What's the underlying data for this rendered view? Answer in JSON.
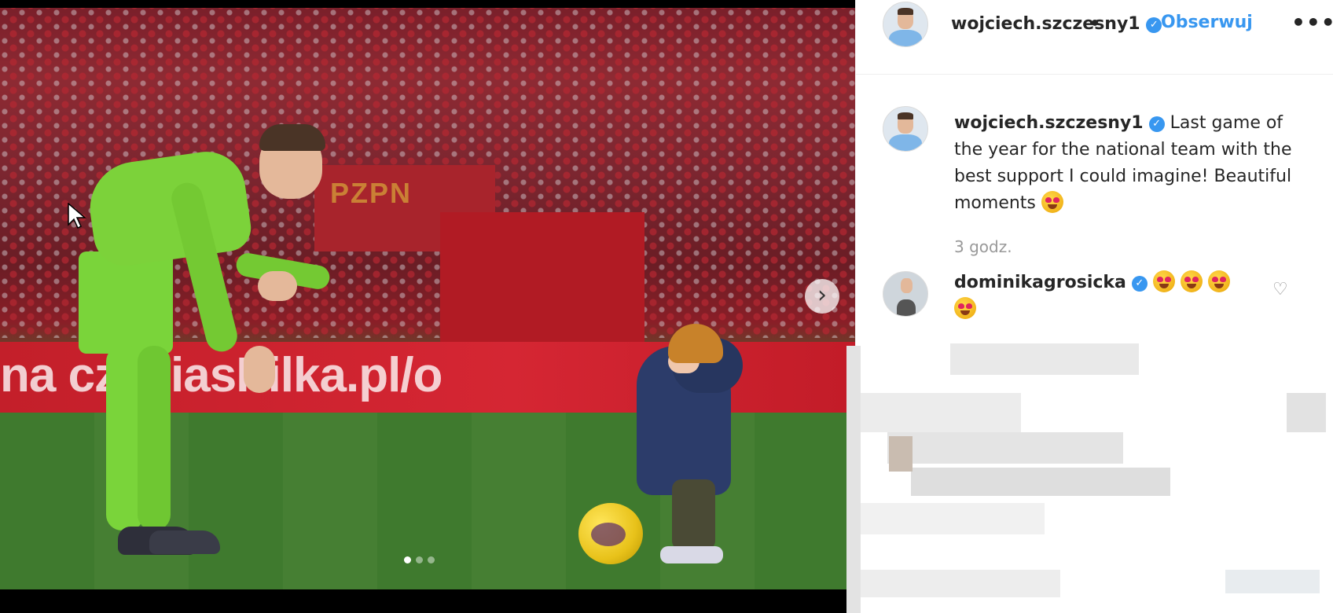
{
  "post": {
    "carousel": {
      "banner_text": "na   czysiasPilka.pl/o",
      "tunnel_sign": "PZPN",
      "dots": [
        true,
        false,
        false
      ],
      "next_icon": "chevron-right-icon"
    }
  },
  "sidebar": {
    "header": {
      "username": "wojciech.szczesny1",
      "verified_icon": "verified-badge-icon",
      "bullet": "•",
      "follow_label": "Obserwuj",
      "more_label": "•••"
    },
    "caption": {
      "username": "wojciech.szczesny1",
      "text": "Last game of the year for the national team with the best support I could imagine! Beautiful moments",
      "emoji": "heart-eyes-emoji"
    },
    "timestamp": "3 godz.",
    "comments": [
      {
        "username": "dominikagrosicka",
        "emoji": [
          "heart-eyes-emoji",
          "heart-eyes-emoji",
          "heart-eyes-emoji",
          "heart-eyes-emoji"
        ],
        "like_icon": "heart-outline-icon"
      }
    ]
  },
  "colors": {
    "accent": "#3897f0",
    "text": "#262626",
    "muted": "#999999"
  }
}
